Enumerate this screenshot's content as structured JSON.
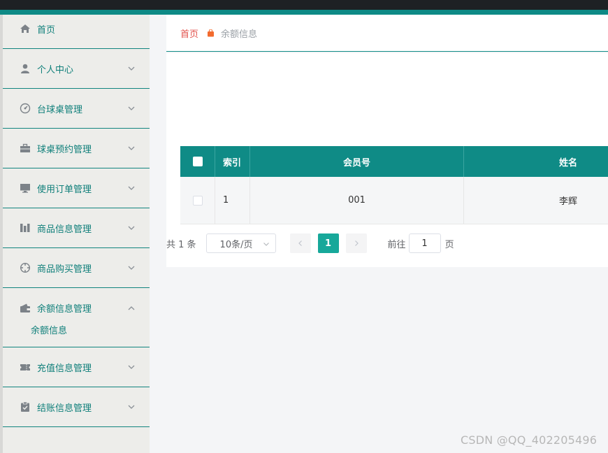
{
  "sidebar": {
    "items": [
      {
        "label": "首页",
        "icon": "home-icon",
        "arrow": ""
      },
      {
        "label": "个人中心",
        "icon": "user-icon",
        "arrow": "down"
      },
      {
        "label": "台球桌管理",
        "icon": "dashboard-icon",
        "arrow": "down"
      },
      {
        "label": "球桌预约管理",
        "icon": "briefcase-icon",
        "arrow": "down"
      },
      {
        "label": "使用订单管理",
        "icon": "monitor-icon",
        "arrow": "down"
      },
      {
        "label": "商品信息管理",
        "icon": "columns-icon",
        "arrow": "down"
      },
      {
        "label": "商品购买管理",
        "icon": "crosshair-icon",
        "arrow": "down"
      },
      {
        "label": "余额信息管理",
        "icon": "wallet-icon",
        "arrow": "up"
      },
      {
        "label": "充值信息管理",
        "icon": "ticket-icon",
        "arrow": "down"
      },
      {
        "label": "结账信息管理",
        "icon": "clipboard-icon",
        "arrow": "down"
      }
    ],
    "sub_item": "余额信息"
  },
  "breadcrumb": {
    "home": "首页",
    "current": "余额信息"
  },
  "table": {
    "headers": {
      "index": "索引",
      "member_no": "会员号",
      "name": "姓名"
    },
    "rows": [
      {
        "index": "1",
        "member_no": "001",
        "name": "李辉"
      }
    ]
  },
  "pagination": {
    "total": "共 1 条",
    "page_size": "10条/页",
    "current_page": "1",
    "goto_label": "前往",
    "goto_value": "1",
    "goto_suffix": "页"
  },
  "watermark": "CSDN @QQ_402205496",
  "colors": {
    "accent": "#0f8b86",
    "active_page": "#17a89a",
    "breadcrumb_home": "#e2534d"
  }
}
